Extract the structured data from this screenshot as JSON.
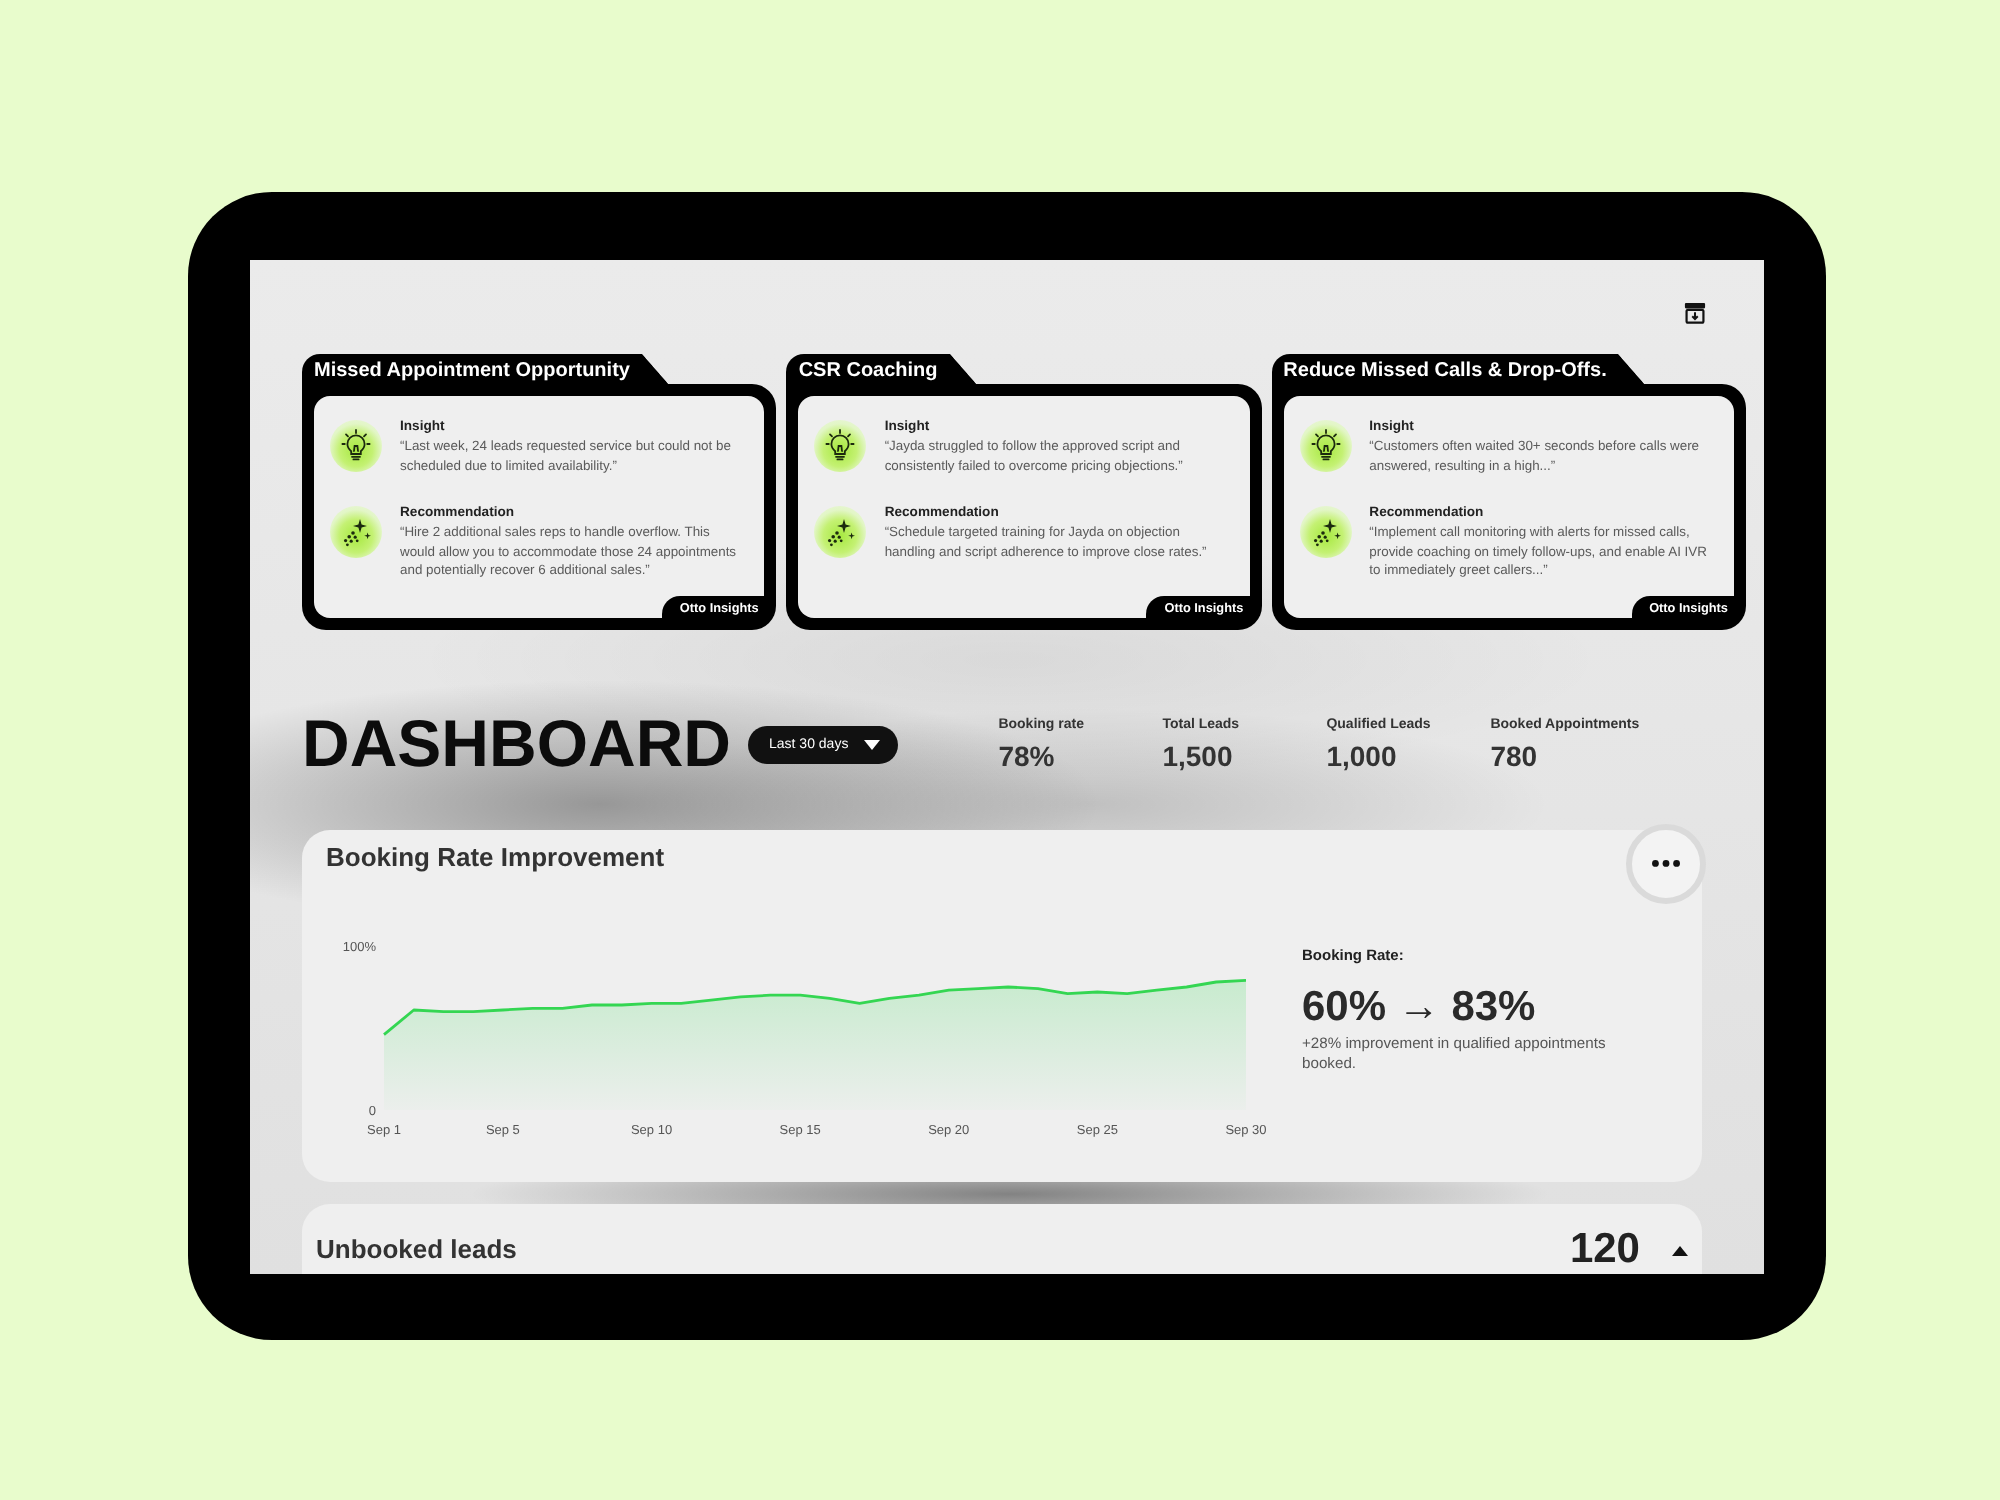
{
  "insight_cards": [
    {
      "title": "Missed Appointment Opportunity",
      "source": "Otto Insights",
      "sections": [
        {
          "kind": "insight",
          "label": "Insight",
          "text": "“Last week, 24 leads requested service but could not be scheduled due to limited availability.”"
        },
        {
          "kind": "recommendation",
          "label": "Recommendation",
          "text": "“Hire 2 additional sales reps to handle overflow. This would allow you to accommodate those 24 appointments and potentially recover 6 additional sales.”"
        }
      ]
    },
    {
      "title": "CSR Coaching",
      "source": "Otto Insights",
      "sections": [
        {
          "kind": "insight",
          "label": "Insight",
          "text": "“Jayda struggled to follow the approved script and consistently failed to overcome pricing objections.”"
        },
        {
          "kind": "recommendation",
          "label": "Recommendation",
          "text": "“Schedule targeted training for Jayda on objection handling and script adherence to improve close rates.”"
        }
      ]
    },
    {
      "title": "Reduce Missed Calls & Drop-Offs.",
      "source": "Otto Insights",
      "sections": [
        {
          "kind": "insight",
          "label": "Insight",
          "text": "“Customers often waited 30+ seconds before calls were answered, resulting in a high...”"
        },
        {
          "kind": "recommendation",
          "label": "Recommendation",
          "text": "“Implement call monitoring with alerts for missed calls, provide coaching on timely follow-ups, and enable AI IVR to immediately greet callers...”"
        }
      ]
    }
  ],
  "dashboard": {
    "title": "DASHBOARD",
    "period": "Last 30 days",
    "stats": [
      {
        "label": "Booking rate",
        "value": "78%"
      },
      {
        "label": "Total Leads",
        "value": "1,500"
      },
      {
        "label": "Qualified Leads",
        "value": "1,000"
      },
      {
        "label": "Booked Appointments",
        "value": "780"
      }
    ]
  },
  "booking_rate_card": {
    "title": "Booking Rate Improvement",
    "chart_data": {
      "type": "area",
      "categories": [
        "Sep 1",
        null,
        null,
        null,
        "Sep 5",
        null,
        null,
        null,
        null,
        "Sep 10",
        null,
        null,
        null,
        null,
        "Sep 15",
        null,
        null,
        null,
        null,
        "Sep 20",
        null,
        null,
        null,
        null,
        "Sep 25",
        null,
        null,
        null,
        null,
        "Sep 30"
      ],
      "values": [
        46,
        61,
        60,
        60,
        61,
        62,
        62,
        64,
        64,
        65,
        65,
        67,
        69,
        70,
        70,
        68,
        65,
        68,
        70,
        73,
        74,
        75,
        74,
        71,
        72,
        71,
        73,
        75,
        78,
        79
      ],
      "yticks": [
        {
          "value": 0,
          "label": "0"
        },
        {
          "value": 100,
          "label": "100%"
        }
      ],
      "ylim": [
        0,
        100
      ]
    },
    "summary": {
      "label": "Booking Rate:",
      "value": "60% → 83%",
      "note": "+28% improvement in qualified appointments booked."
    }
  },
  "unbooked_leads": {
    "title": "Unbooked leads",
    "count": "120",
    "expanded": true
  }
}
